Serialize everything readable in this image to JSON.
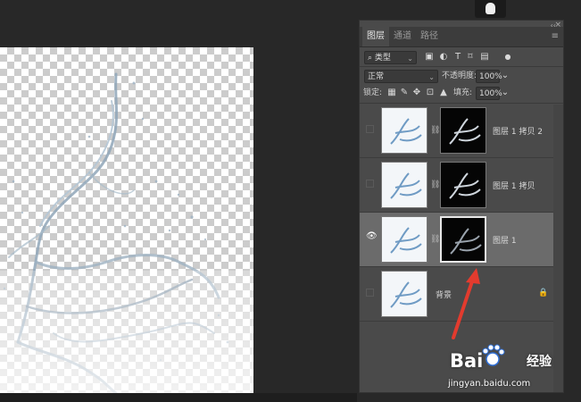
{
  "panel": {
    "tabs": [
      "图层",
      "通道",
      "路径"
    ],
    "active_tab": 0,
    "filter": {
      "label": "类型"
    },
    "blend_mode": "正常",
    "opacity": {
      "label": "不透明度:",
      "value": "100%"
    },
    "lock": {
      "label": "锁定:"
    },
    "fill": {
      "label": "填充:",
      "value": "100%"
    }
  },
  "layers": [
    {
      "name": "图层 1 拷贝 2",
      "visible": false,
      "has_mask": true,
      "selected": false,
      "locked": false
    },
    {
      "name": "图层 1 拷贝",
      "visible": false,
      "has_mask": true,
      "selected": false,
      "locked": false
    },
    {
      "name": "图层 1",
      "visible": true,
      "has_mask": true,
      "selected": true,
      "locked": false
    },
    {
      "name": "背景",
      "visible": false,
      "has_mask": false,
      "selected": false,
      "locked": true
    }
  ],
  "watermark": {
    "brand": "Bai",
    "brand_cn": "经验",
    "url": "jingyan.baidu.com"
  },
  "icons": {
    "filter_icons": [
      "image-filter-icon",
      "adjustment-filter-icon",
      "type-filter-icon",
      "shape-filter-icon",
      "smart-object-filter-icon",
      "filter-toggle-icon"
    ],
    "lock_icons": [
      "lock-transparent-icon",
      "lock-image-icon",
      "lock-position-icon",
      "lock-artboard-icon",
      "lock-all-icon"
    ]
  },
  "colors": {
    "panel_bg": "#4a4a4a",
    "selected_row": "#6b6b6b",
    "app_bg": "#282828",
    "arrow": "#e23b2e"
  }
}
